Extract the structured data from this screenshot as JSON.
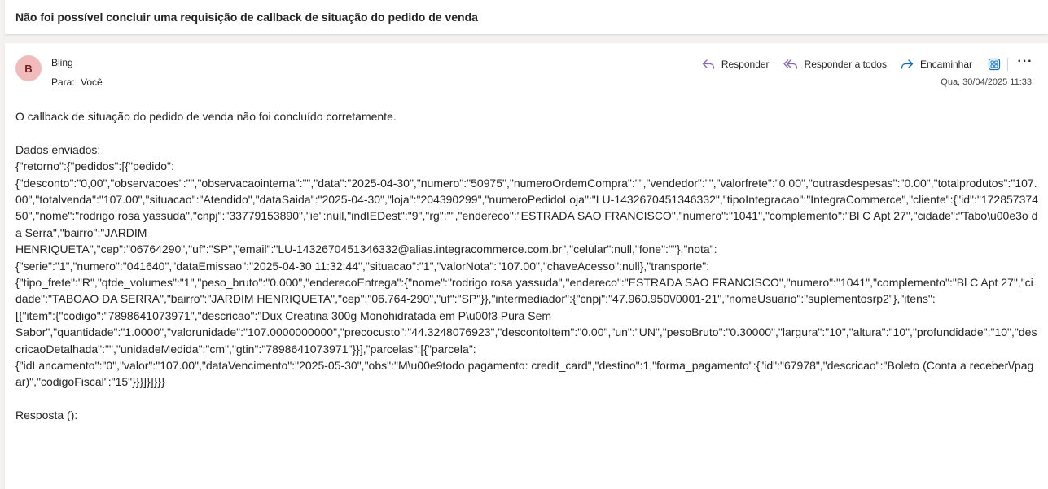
{
  "subject": "Não foi possível concluir uma requisição de callback de situação do pedido de venda",
  "sender": {
    "initial": "B",
    "name": "Bling",
    "to_label": "Para:",
    "to_value": "Você"
  },
  "actions": {
    "reply": "Responder",
    "reply_all": "Responder a todos",
    "forward": "Encaminhar"
  },
  "date": "Qua, 30/04/2025 11:33",
  "body": {
    "intro": "O callback de situação do pedido de venda não foi concluído corretamente.",
    "sent_label": "Dados enviados:",
    "json_lines": [
      "{\"retorno\":{\"pedidos\":[{\"pedido\":",
      "{\"desconto\":\"0,00\",\"observacoes\":\"\",\"observacaointerna\":\"\",\"data\":\"2025-04-30\",\"numero\":\"50975\",\"numeroOrdemCompra\":\"\",\"vendedor\":\"\",\"valorfrete\":\"0.00\",\"outrasdespesas\":\"0.00\",\"totalprodutos\":\"107.00\",\"totalvenda\":\"107.00\",\"situacao\":\"Atendido\",\"dataSaida\":\"2025-04-30\",\"loja\":\"204390299\",\"numeroPedidoLoja\":\"LU-1432670451346332\",\"tipoIntegracao\":\"IntegraCommerce\",\"cliente\":{\"id\":\"17285737450\",\"nome\":\"rodrigo rosa yassuda\",\"cnpj\":\"33779153890\",\"ie\":null,\"indIEDest\":\"9\",\"rg\":\"\",\"endereco\":\"ESTRADA SAO FRANCISCO\",\"numero\":\"1041\",\"complemento\":\"Bl C Apt 27\",\"cidade\":\"Tabo\\u00e3o da Serra\",\"bairro\":\"JARDIM",
      "HENRIQUETA\",\"cep\":\"06764290\",\"uf\":\"SP\",\"email\":\"LU-1432670451346332@alias.integracommerce.com.br\",\"celular\":null,\"fone\":\"\"},\"nota\":",
      "{\"serie\":\"1\",\"numero\":\"041640\",\"dataEmissao\":\"2025-04-30 11:32:44\",\"situacao\":\"1\",\"valorNota\":\"107.00\",\"chaveAcesso\":null},\"transporte\":",
      "{\"tipo_frete\":\"R\",\"qtde_volumes\":\"1\",\"peso_bruto\":\"0.000\",\"enderecoEntrega\":{\"nome\":\"rodrigo rosa yassuda\",\"endereco\":\"ESTRADA SAO FRANCISCO\",\"numero\":\"1041\",\"complemento\":\"Bl C Apt 27\",\"cidade\":\"TABOAO DA SERRA\",\"bairro\":\"JARDIM HENRIQUETA\",\"cep\":\"06.764-290\",\"uf\":\"SP\"}},\"intermediador\":{\"cnpj\":\"47.960.950\\/0001-21\",\"nomeUsuario\":\"suplementosrp2\"},\"itens\":",
      "[{\"item\":{\"codigo\":\"7898641073971\",\"descricao\":\"Dux Creatina 300g Monohidratada em P\\u00f3 Pura Sem",
      "Sabor\",\"quantidade\":\"1.0000\",\"valorunidade\":\"107.0000000000\",\"precocusto\":\"44.3248076923\",\"descontoItem\":\"0.00\",\"un\":\"UN\",\"pesoBruto\":\"0.30000\",\"largura\":\"10\",\"altura\":\"10\",\"profundidade\":\"10\",\"descricaoDetalhada\":\"\",\"unidadeMedida\":\"cm\",\"gtin\":\"7898641073971\"}}],\"parcelas\":[{\"parcela\":",
      "{\"idLancamento\":\"0\",\"valor\":\"107.00\",\"dataVencimento\":\"2025-05-30\",\"obs\":\"M\\u00e9todo pagamento: credit_card\",\"destino\":1,\"forma_pagamento\":{\"id\":\"67978\",\"descricao\":\"Boleto (Conta a receber\\/pagar)\",\"codigoFiscal\":\"15\"}}}]}]}}}"
    ],
    "response_label": "Resposta ():"
  },
  "colors": {
    "avatar_bg": "#f1bbbc",
    "avatar_fg": "#751d1f",
    "icon_purple": "#8764b8",
    "icon_blue": "#0f6cbd"
  }
}
